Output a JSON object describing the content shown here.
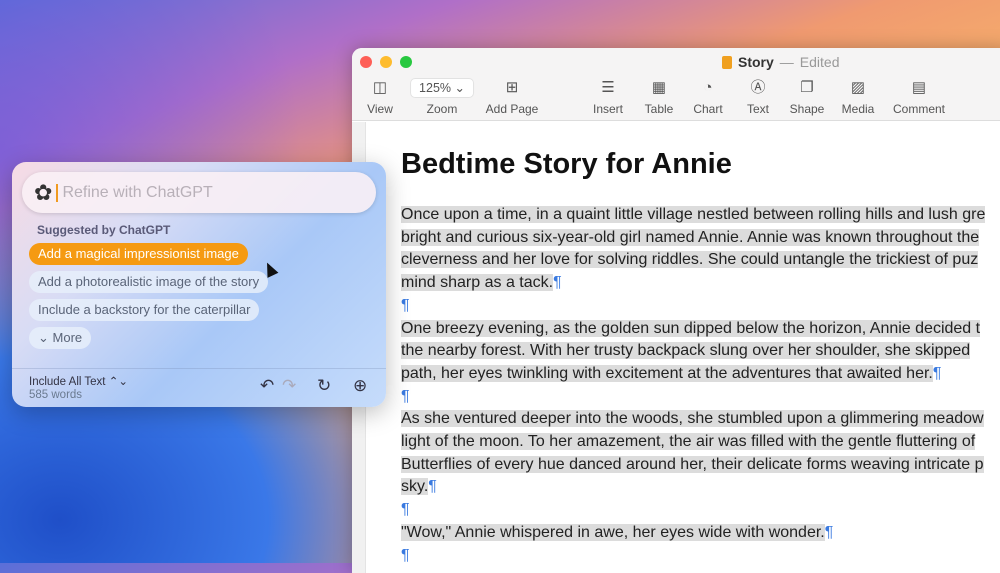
{
  "window": {
    "title": "Story",
    "status": "Edited"
  },
  "toolbar": [
    {
      "label": "View",
      "icon": "sidebar-icon",
      "glyph": "◫"
    },
    {
      "label": "Zoom",
      "value": "125% ⌄"
    },
    {
      "label": "Add Page",
      "icon": "add-page-icon",
      "glyph": "⊞"
    },
    {
      "label": "Insert",
      "icon": "insert-icon",
      "glyph": "☰"
    },
    {
      "label": "Table",
      "icon": "table-icon",
      "glyph": "▦"
    },
    {
      "label": "Chart",
      "icon": "chart-icon",
      "glyph": "◔"
    },
    {
      "label": "Text",
      "icon": "text-icon",
      "glyph": "Ⓐ"
    },
    {
      "label": "Shape",
      "icon": "shape-icon",
      "glyph": "❐"
    },
    {
      "label": "Media",
      "icon": "media-icon",
      "glyph": "▨"
    },
    {
      "label": "Comment",
      "icon": "comment-icon",
      "glyph": "▤"
    }
  ],
  "document": {
    "title": "Bedtime Story for Annie",
    "lines": [
      "Once upon a time, in a quaint little village nestled between rolling hills and lush gre",
      "bright and curious six-year-old girl named Annie. Annie was known throughout the",
      "cleverness and her love for solving riddles. She could untangle the trickiest of puz",
      "mind sharp as a tack.",
      "",
      "One breezy evening, as the golden sun dipped below the horizon, Annie decided t",
      "the nearby forest. With her trusty backpack slung over her shoulder, she skipped",
      "path, her eyes twinkling with excitement at the adventures that awaited her.",
      "",
      "As she ventured deeper into the woods, she stumbled upon a glimmering meadow",
      "light of the moon. To her amazement, the air was filled with the gentle fluttering of",
      "Butterflies of every hue danced around her, their delicate forms weaving intricate p",
      "sky.",
      "",
      "\"Wow,\" Annie whispered in awe, her eyes wide with wonder.",
      ""
    ],
    "pilcrow": "¶"
  },
  "chatgpt": {
    "placeholder": "Refine with ChatGPT",
    "suggested_label": "Suggested by ChatGPT",
    "suggestions": [
      "Add a magical impressionist image",
      "Add a photorealistic image of the story",
      "Include a backstory for the caterpillar"
    ],
    "more": "⌄ More",
    "include": "Include All Text ⌃⌄",
    "word_count": "585 words",
    "accent": "#f59a12"
  }
}
